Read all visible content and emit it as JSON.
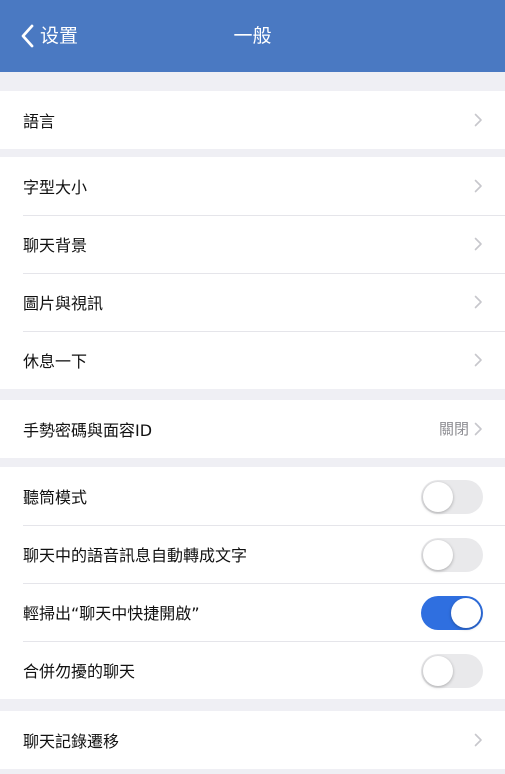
{
  "nav": {
    "back_label": "设置",
    "title": "一般"
  },
  "groups": [
    {
      "rows": [
        {
          "label": "語言"
        }
      ]
    },
    {
      "rows": [
        {
          "label": "字型大小"
        },
        {
          "label": "聊天背景"
        },
        {
          "label": "圖片與視訊"
        },
        {
          "label": "休息一下"
        }
      ]
    },
    {
      "rows": [
        {
          "label": "手勢密碼與面容ID",
          "value": "關閉"
        }
      ]
    },
    {
      "rows": [
        {
          "label": "聽筒模式",
          "toggle": false
        },
        {
          "label": "聊天中的語音訊息自動轉成文字",
          "toggle": false
        },
        {
          "label": "輕掃出“聊天中快捷開啟”",
          "toggle": true
        },
        {
          "label": "合併勿擾的聊天",
          "toggle": false
        }
      ]
    },
    {
      "rows": [
        {
          "label": "聊天記錄遷移"
        }
      ]
    }
  ],
  "colors": {
    "nav_bar": "#4a79c2",
    "background": "#efeff4",
    "toggle_on": "#2f6fe0",
    "toggle_off": "#e9e9eb"
  },
  "icons": {
    "back": "chevron-left-icon",
    "row_disclosure": "chevron-right-icon"
  }
}
